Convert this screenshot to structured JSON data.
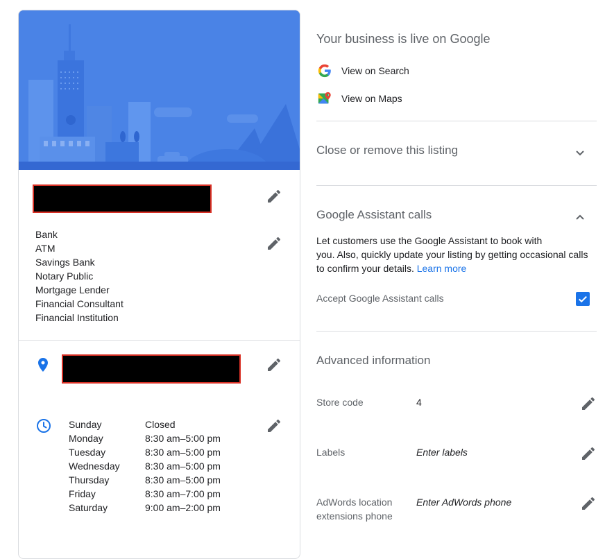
{
  "card": {
    "categories": [
      "Bank",
      "ATM",
      "Savings Bank",
      "Notary Public",
      "Mortgage Lender",
      "Financial Consultant",
      "Financial Institution"
    ],
    "hours": [
      {
        "day": "Sunday",
        "time": "Closed"
      },
      {
        "day": "Monday",
        "time": "8:30 am–5:00 pm"
      },
      {
        "day": "Tuesday",
        "time": "8:30 am–5:00 pm"
      },
      {
        "day": "Wednesday",
        "time": "8:30 am–5:00 pm"
      },
      {
        "day": "Thursday",
        "time": "8:30 am–5:00 pm"
      },
      {
        "day": "Friday",
        "time": "8:30 am–7:00 pm"
      },
      {
        "day": "Saturday",
        "time": "9:00 am–2:00 pm"
      }
    ]
  },
  "live": {
    "title": "Your business is live on Google",
    "view_search": "View on Search",
    "view_maps": "View on Maps"
  },
  "close_section": {
    "title": "Close or remove this listing"
  },
  "assistant": {
    "title": "Google Assistant calls",
    "description_line1": "Let customers use the Google Assistant to book with",
    "description_line2": "you. Also, quickly update your listing by getting occasional calls",
    "description_line3": "to confirm your details.",
    "learn_more": "Learn more",
    "accept_label": "Accept Google Assistant calls",
    "accept_checked": true
  },
  "advanced": {
    "title": "Advanced information",
    "store_code_label": "Store code",
    "store_code_value": "4",
    "labels_label": "Labels",
    "labels_placeholder": "Enter labels",
    "adwords_label_line1": "AdWords location",
    "adwords_label_line2": "extensions phone",
    "adwords_placeholder": "Enter AdWords phone"
  },
  "colors": {
    "accent": "#1a73e8",
    "hero": "#4a83e6",
    "redaction_border": "#d93025"
  }
}
